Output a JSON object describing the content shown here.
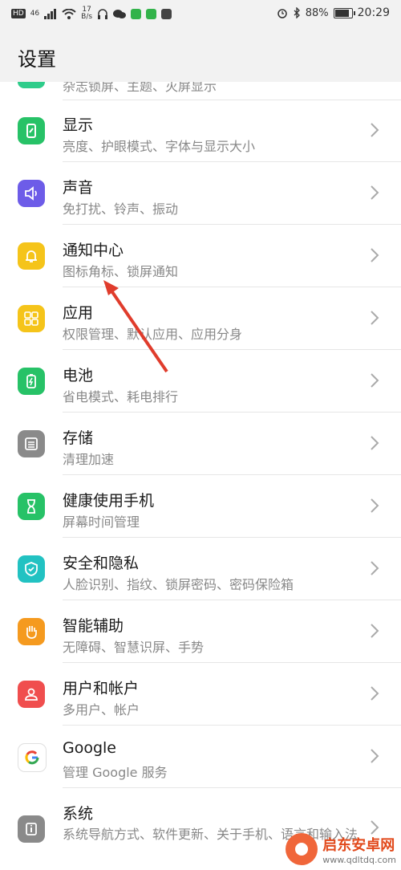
{
  "status_bar": {
    "network_badge": "HD",
    "network_type": "46",
    "speed_value": "17",
    "speed_unit": "B/s",
    "battery_percent": "88%",
    "time": "20:29"
  },
  "header": {
    "title": "设置"
  },
  "partial_row": {
    "subtitle": "杂志锁屏、主题、灭屏显示"
  },
  "items": [
    {
      "title": "显示",
      "subtitle": "亮度、护眼模式、字体与显示大小",
      "color": "#27c267",
      "icon": "display-icon"
    },
    {
      "title": "声音",
      "subtitle": "免打扰、铃声、振动",
      "color": "#6d5ce8",
      "icon": "sound-icon"
    },
    {
      "title": "通知中心",
      "subtitle": "图标角标、锁屏通知",
      "color": "#f5c41a",
      "icon": "bell-icon"
    },
    {
      "title": "应用",
      "subtitle": "权限管理、默认应用、应用分身",
      "color": "#f5c41a",
      "icon": "apps-grid-icon"
    },
    {
      "title": "电池",
      "subtitle": "省电模式、耗电排行",
      "color": "#27c267",
      "icon": "battery-icon"
    },
    {
      "title": "存储",
      "subtitle": "清理加速",
      "color": "#8a8a8a",
      "icon": "storage-icon"
    },
    {
      "title": "健康使用手机",
      "subtitle": "屏幕时间管理",
      "color": "#27c267",
      "icon": "hourglass-icon"
    },
    {
      "title": "安全和隐私",
      "subtitle": "人脸识别、指纹、锁屏密码、密码保险箱",
      "color": "#22c2c2",
      "icon": "shield-icon"
    },
    {
      "title": "智能辅助",
      "subtitle": "无障碍、智慧识屏、手势",
      "color": "#f59a1f",
      "icon": "hand-icon"
    },
    {
      "title": "用户和帐户",
      "subtitle": "多用户、帐户",
      "color": "#f04e4e",
      "icon": "user-icon"
    },
    {
      "title": "Google",
      "subtitle": "管理 Google 服务",
      "color": "#ffffff",
      "icon": "google-icon"
    },
    {
      "title": "系统",
      "subtitle": "系统导航方式、软件更新、关于手机、语言和输入法",
      "color": "#8a8a8a",
      "icon": "info-icon"
    }
  ],
  "watermark": {
    "name": "启东安卓网",
    "url": "www.qdltdq.com"
  }
}
